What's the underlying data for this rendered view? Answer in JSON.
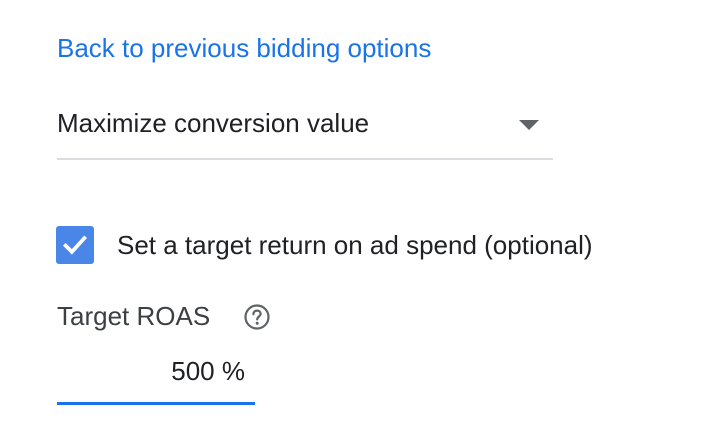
{
  "back_link": {
    "label": "Back to previous bidding options"
  },
  "bidding_strategy": {
    "selected": "Maximize conversion value",
    "icon": "arrow-drop-down-icon"
  },
  "target_checkbox": {
    "checked": true,
    "label": "Set a target return on ad spend (optional)",
    "color": "#4a86e8"
  },
  "target_roas": {
    "label": "Target ROAS",
    "help_icon": "help-circle-icon",
    "value": "500 %",
    "underline_color": "#1a73e8"
  },
  "colors": {
    "link": "#1a73e8",
    "text": "#202124",
    "divider": "#dadce0"
  }
}
